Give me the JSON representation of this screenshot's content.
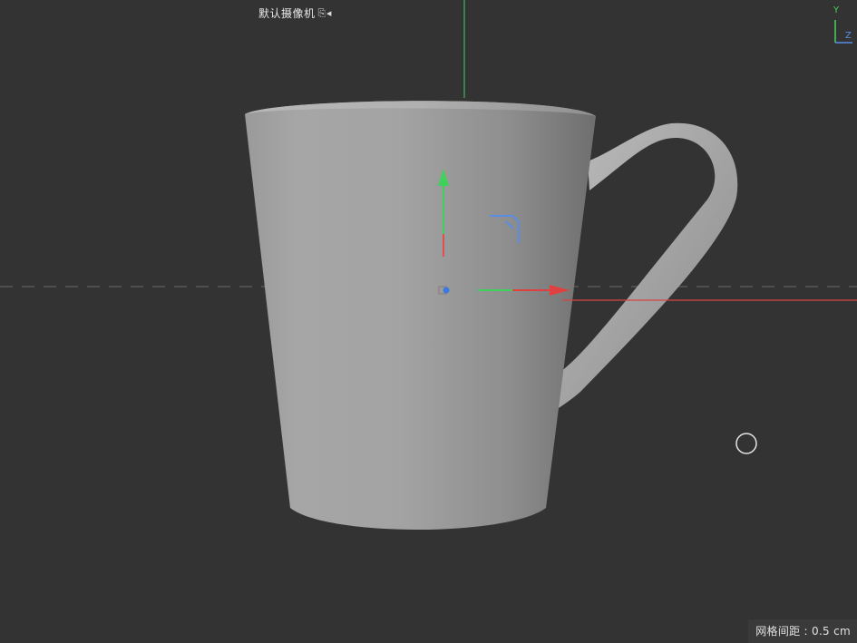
{
  "viewport": {
    "camera_label": "默认摄像机",
    "camera_icon": "camera-icon",
    "grid_spacing_label": "网格间距 : 0.5 cm"
  },
  "axis_gizmo": {
    "y_label": "Y",
    "z_label": "Z",
    "y_color": "#49d15c",
    "z_color": "#5a8de6",
    "x_color": "#e03a3a"
  },
  "colors": {
    "background": "#333333",
    "mug_light": "#a9a9a9",
    "mug_dark": "#7c7c7c"
  }
}
